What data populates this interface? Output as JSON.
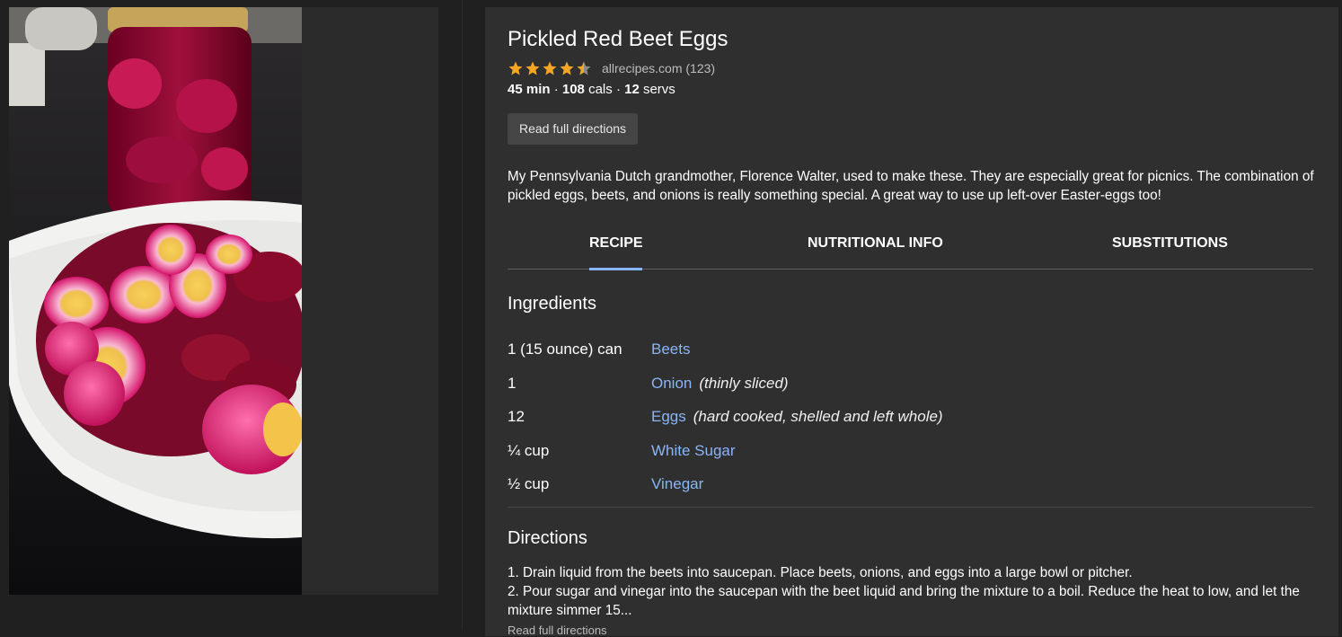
{
  "recipe": {
    "title": "Pickled Red Beet Eggs",
    "rating": 4.5,
    "source": "allrecipes.com (123)",
    "time": "45 min",
    "cals_value": "108",
    "cals_label": "cals",
    "servs_value": "12",
    "servs_label": "servs",
    "separator": "·",
    "read_full_label": "Read full directions",
    "description": "My Pennsylvania Dutch grandmother, Florence Walter, used to make these. They are especially great for picnics. The combination of pickled eggs, beets, and onions is really something special. A great way to use up left-over Easter-eggs too!"
  },
  "tabs": [
    {
      "label": "RECIPE",
      "active": true
    },
    {
      "label": "NUTRITIONAL INFO",
      "active": false
    },
    {
      "label": "SUBSTITUTIONS",
      "active": false
    }
  ],
  "ingredients": {
    "heading": "Ingredients",
    "items": [
      {
        "qty": "1 (15 ounce) can",
        "name": "Beets",
        "note": ""
      },
      {
        "qty": "1",
        "name": "Onion",
        "note": "(thinly sliced)"
      },
      {
        "qty": "12",
        "name": "Eggs",
        "note": "(hard cooked, shelled and left whole)"
      },
      {
        "qty": "¼ cup",
        "name": "White Sugar",
        "note": ""
      },
      {
        "qty": "½ cup",
        "name": "Vinegar",
        "note": ""
      }
    ]
  },
  "directions": {
    "heading": "Directions",
    "step1": "1. Drain liquid from the beets into saucepan. Place beets, onions, and eggs into a large bowl or pitcher.",
    "step2": "2. Pour sugar and vinegar into the saucepan with the beet liquid and bring the mixture to a boil. Reduce the heat to low, and let the mixture simmer 15...",
    "read_full_label": "Read full directions"
  },
  "colors": {
    "link": "#8ab4f8",
    "star": "#f5a623",
    "background": "#202020",
    "card": "#2f2f2f"
  },
  "icons": [
    "star-icon",
    "half-star-icon"
  ]
}
